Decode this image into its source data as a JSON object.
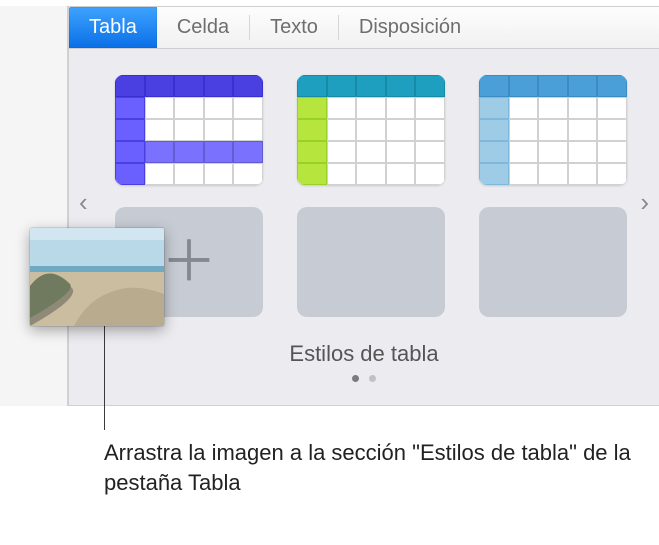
{
  "tabs": {
    "tabla": "Tabla",
    "celda": "Celda",
    "texto": "Texto",
    "disposicion": "Disposición"
  },
  "section": {
    "label": "Estilos de tabla"
  },
  "placeholder": {
    "add_glyph": "＋"
  },
  "nav": {
    "prev": "‹",
    "next": "›"
  },
  "callout": {
    "text": "Arrastra la imagen a la sección \"Estilos de tabla\" de la pestaña Tabla"
  }
}
